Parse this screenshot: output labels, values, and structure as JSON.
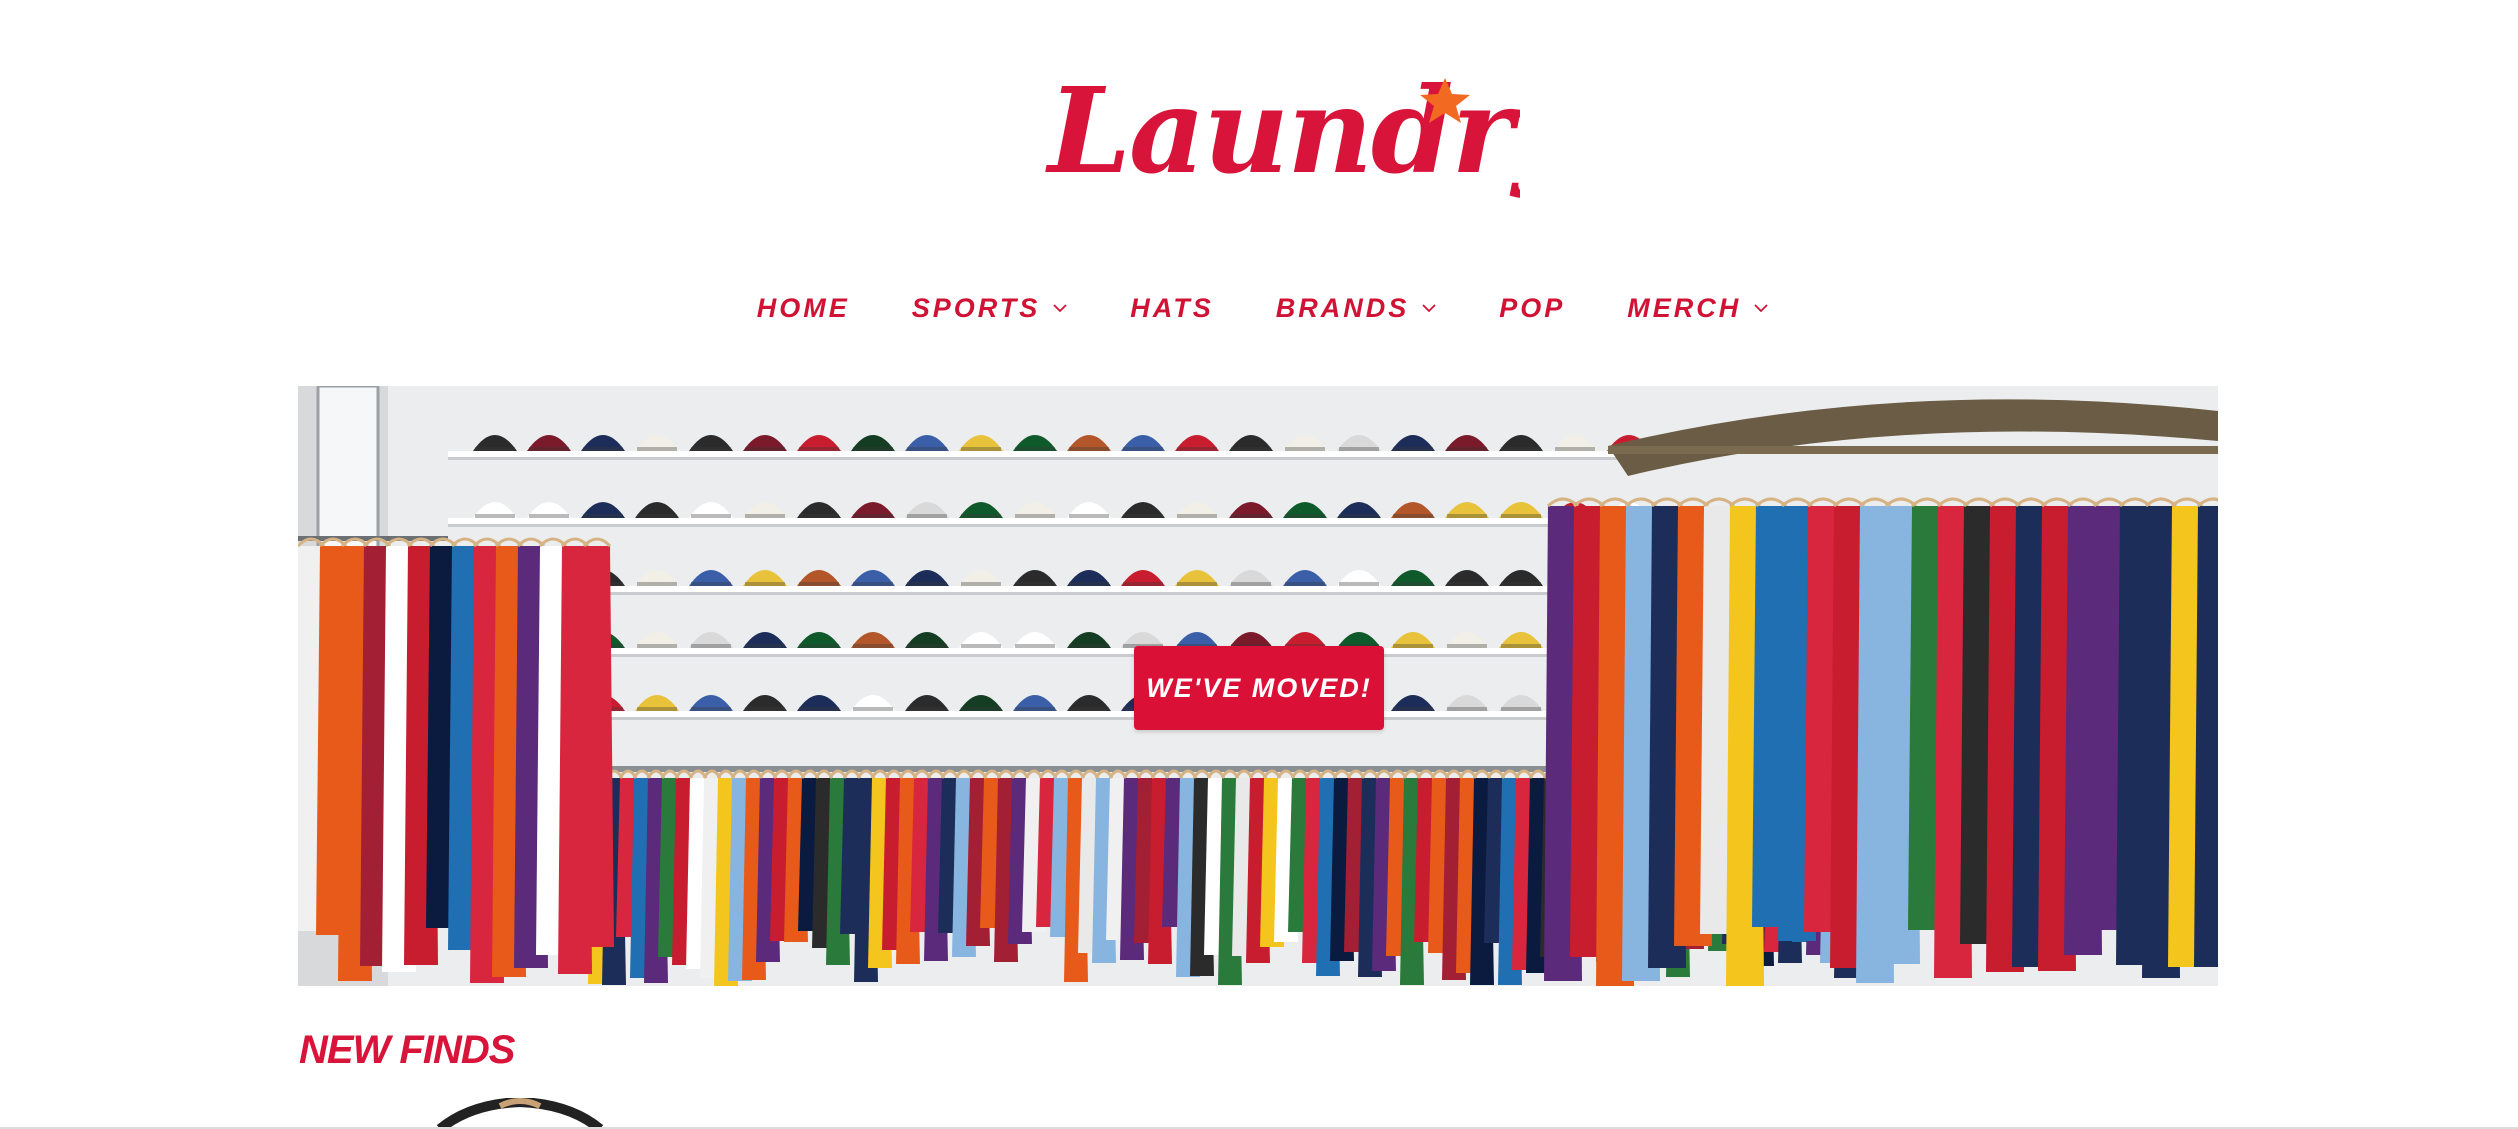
{
  "brand": {
    "logo_text": "Laundry",
    "logo_color": "#d8143a",
    "star_color": "#f26a21"
  },
  "nav": {
    "items": [
      {
        "label": "HOME",
        "has_dropdown": false,
        "icon": null
      },
      {
        "label": "SPORTS",
        "has_dropdown": true,
        "icon": "chevron-down-icon"
      },
      {
        "label": "HATS",
        "has_dropdown": false,
        "icon": null
      },
      {
        "label": "BRANDS",
        "has_dropdown": true,
        "icon": "chevron-down-icon"
      },
      {
        "label": "POP",
        "has_dropdown": false,
        "icon": null
      },
      {
        "label": "MERCH",
        "has_dropdown": true,
        "icon": "chevron-down-icon"
      }
    ],
    "color": "#d01235"
  },
  "hero": {
    "cta_label": "WE'VE MOVED!",
    "cta_color": "#db1036",
    "image_description_icon": "store-interior-image"
  },
  "sections": {
    "new_finds_title": "NEW FINDS"
  }
}
